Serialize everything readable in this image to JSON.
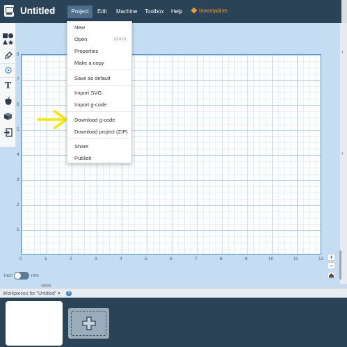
{
  "header": {
    "title": "Untitled",
    "star": "☆",
    "menu": [
      "Project",
      "Edit",
      "Machine",
      "Toolbox",
      "Help"
    ],
    "inventables": "Inventables"
  },
  "project_menu": {
    "items": [
      {
        "label": "New"
      },
      {
        "label": "Open",
        "shortcut": "Ctrl O"
      },
      {
        "label": "Properties"
      },
      {
        "label": "Make a copy"
      },
      {
        "label": "Save as default"
      },
      {
        "label": "Import SVG"
      },
      {
        "label": "Import g-code"
      },
      {
        "label": "Download g-code"
      },
      {
        "label": "Download project (ZIP)"
      },
      {
        "label": "Share"
      },
      {
        "label": "Publish"
      }
    ]
  },
  "toolbar": {
    "tools": [
      "shapes-icon",
      "pen-icon",
      "point-icon",
      "text-icon",
      "apple-icon",
      "box-icon",
      "import-icon"
    ],
    "text_tool": "T"
  },
  "canvas": {
    "x_ticks": [
      "0",
      "1",
      "2",
      "3",
      "4",
      "5",
      "6",
      "7",
      "8",
      "9",
      "10",
      "11",
      "12"
    ],
    "y_ticks": [
      "8",
      "7",
      "6",
      "5",
      "4",
      "3",
      "2",
      "1"
    ]
  },
  "zoom": {
    "plus": "+",
    "minus": "−"
  },
  "units": {
    "left": "inch",
    "right": "mm"
  },
  "workpieces": {
    "title": "Workpieces for \"Untitled\"",
    "help": "?"
  },
  "colors": {
    "header_bg": "#2a4357",
    "accent": "#f09c2b",
    "grid_border": "#4a8fd0",
    "highlight_arrow": "#f5e600"
  }
}
